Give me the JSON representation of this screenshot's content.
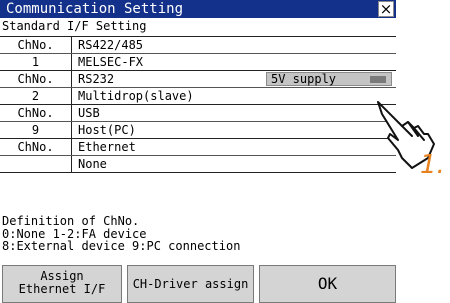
{
  "window": {
    "title": "Communication Setting",
    "close_glyph": "×"
  },
  "section_title": "Standard I/F Setting",
  "channels": [
    {
      "header_label": "ChNo.",
      "header_value": "RS422/485",
      "number": "1",
      "value": "MELSEC-FX"
    },
    {
      "header_label": "ChNo.",
      "header_value": "RS232",
      "number": "2",
      "value": "Multidrop(slave)",
      "option_label": "5V supply",
      "option_checked": true
    },
    {
      "header_label": "ChNo.",
      "header_value": "USB",
      "number": "9",
      "value": "Host(PC)"
    },
    {
      "header_label": "ChNo.",
      "header_value": "Ethernet",
      "number": "",
      "value": "None"
    }
  ],
  "definition": {
    "line1": "Definition of ChNo.",
    "line2": "0:None 1-2:FA device",
    "line3": "8:External device 9:PC connection"
  },
  "buttons": {
    "assign_line1": "Assign",
    "assign_line2": "Ethernet I/F",
    "driver": "CH-Driver assign",
    "ok": "OK"
  },
  "annotation": {
    "step": "1.",
    "color": "#e8821e",
    "icon": "pointing-hand-icon"
  },
  "colors": {
    "titlebar": "#13318a",
    "button_bg": "#d4d4d4",
    "option_bg": "#c4c4c4"
  }
}
